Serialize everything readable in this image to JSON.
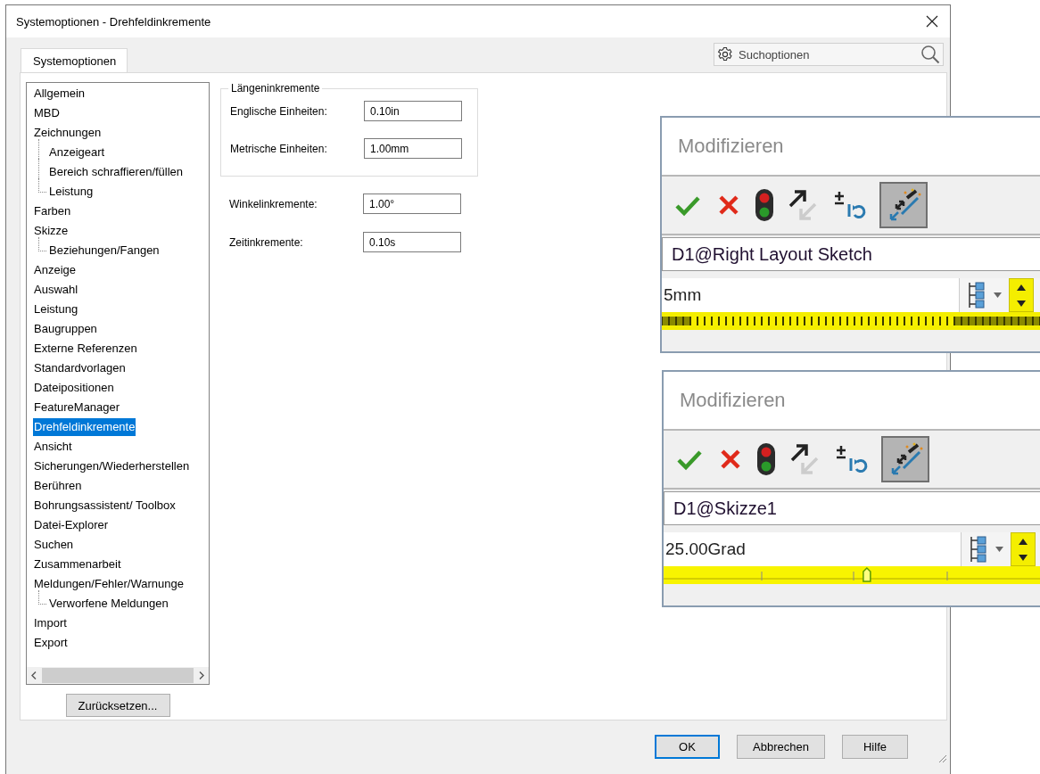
{
  "window": {
    "title": "Systemoptionen - Drehfeldinkremente"
  },
  "tabs": [
    {
      "label": "Systemoptionen",
      "selected": true
    }
  ],
  "search": {
    "placeholder": "Suchoptionen"
  },
  "tree": [
    {
      "label": "Allgemein",
      "selected": false
    },
    {
      "label": "MBD",
      "selected": false
    },
    {
      "label": "Zeichnungen",
      "selected": false,
      "children": [
        {
          "label": "Anzeigeart",
          "selected": false
        },
        {
          "label": "Bereich schraffieren/füllen",
          "selected": false
        },
        {
          "label": "Leistung",
          "selected": false
        }
      ]
    },
    {
      "label": "Farben",
      "selected": false
    },
    {
      "label": "Skizze",
      "selected": false,
      "children": [
        {
          "label": "Beziehungen/Fangen",
          "selected": false
        }
      ]
    },
    {
      "label": "Anzeige",
      "selected": false
    },
    {
      "label": "Auswahl",
      "selected": false
    },
    {
      "label": "Leistung",
      "selected": false
    },
    {
      "label": "Baugruppen",
      "selected": false
    },
    {
      "label": "Externe Referenzen",
      "selected": false
    },
    {
      "label": "Standardvorlagen",
      "selected": false
    },
    {
      "label": "Dateipositionen",
      "selected": false
    },
    {
      "label": "FeatureManager",
      "selected": false
    },
    {
      "label": "Drehfeldinkremente",
      "selected": true
    },
    {
      "label": "Ansicht",
      "selected": false
    },
    {
      "label": "Sicherungen/Wiederherstellen",
      "selected": false
    },
    {
      "label": "Berühren",
      "selected": false
    },
    {
      "label": "Bohrungsassistent/ Toolbox",
      "selected": false
    },
    {
      "label": "Datei-Explorer",
      "selected": false
    },
    {
      "label": "Suchen",
      "selected": false
    },
    {
      "label": "Zusammenarbeit",
      "selected": false
    },
    {
      "label": "Meldungen/Fehler/Warnunge",
      "selected": false,
      "children": [
        {
          "label": "Verworfene Meldungen",
          "selected": false
        }
      ]
    },
    {
      "label": "Import",
      "selected": false
    },
    {
      "label": "Export",
      "selected": false
    }
  ],
  "group": {
    "title": "Längeninkremente",
    "fields": [
      {
        "label": "Englische Einheiten:",
        "value": "0.10in"
      },
      {
        "label": "Metrische Einheiten:",
        "value": "1.00mm"
      }
    ]
  },
  "fields": [
    {
      "label": "Winkelinkremente:",
      "value": "1.00°"
    },
    {
      "label": "Zeitinkremente:",
      "value": "0.10s"
    }
  ],
  "reset_button": "Zurücksetzen...",
  "buttons": [
    {
      "label": "OK",
      "default": true
    },
    {
      "label": "Abbrechen",
      "default": false
    },
    {
      "label": "Hilfe",
      "default": false
    }
  ],
  "popups": [
    {
      "title": "Modifizieren",
      "name": "D1@Right Layout Sketch",
      "value": "5mm",
      "kind": "wheel",
      "wand_pressed": true
    },
    {
      "title": "Modifizieren",
      "name": "D1@Skizze1",
      "value": "25.00Grad",
      "kind": "slider",
      "level": 0.54,
      "wand_pressed": true
    }
  ]
}
